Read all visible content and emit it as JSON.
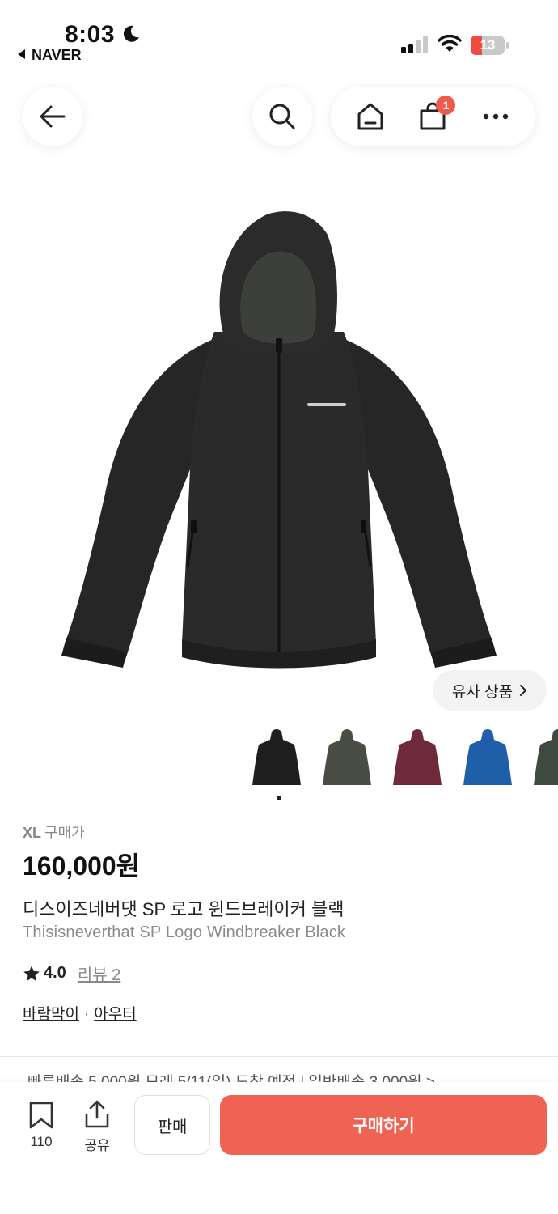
{
  "status_bar": {
    "time": "8:03",
    "back_app": "NAVER",
    "battery": "13"
  },
  "nav": {
    "cart_count": "1"
  },
  "gallery": {
    "similar_label": "유사 상품",
    "colors": [
      "#1f1f1f",
      "#4a4d44",
      "#6e2a3a",
      "#1f5ea8",
      "#3f4a3e"
    ]
  },
  "product": {
    "size": "XL",
    "price_label": "구매가",
    "price": "160,000원",
    "title_ko": "디스이즈네버댓 SP 로고 윈드브레이커 블랙",
    "title_en": "Thisisneverthat SP Logo Windbreaker Black",
    "rating": "4.0",
    "review_label": "리뷰 2",
    "category_1": "바람막이",
    "category_2": "아우터",
    "shipping_text": "빠른배송 5,000원 모레 5/11(일) 도착 예정   |   일반배송 3,000원 >"
  },
  "bottom_bar": {
    "save_count": "110",
    "share_label": "공유",
    "sell_label": "판매",
    "buy_label": "구매하기"
  },
  "colors": {
    "accent": "#ef6352",
    "badge": "#ef5a4a"
  }
}
